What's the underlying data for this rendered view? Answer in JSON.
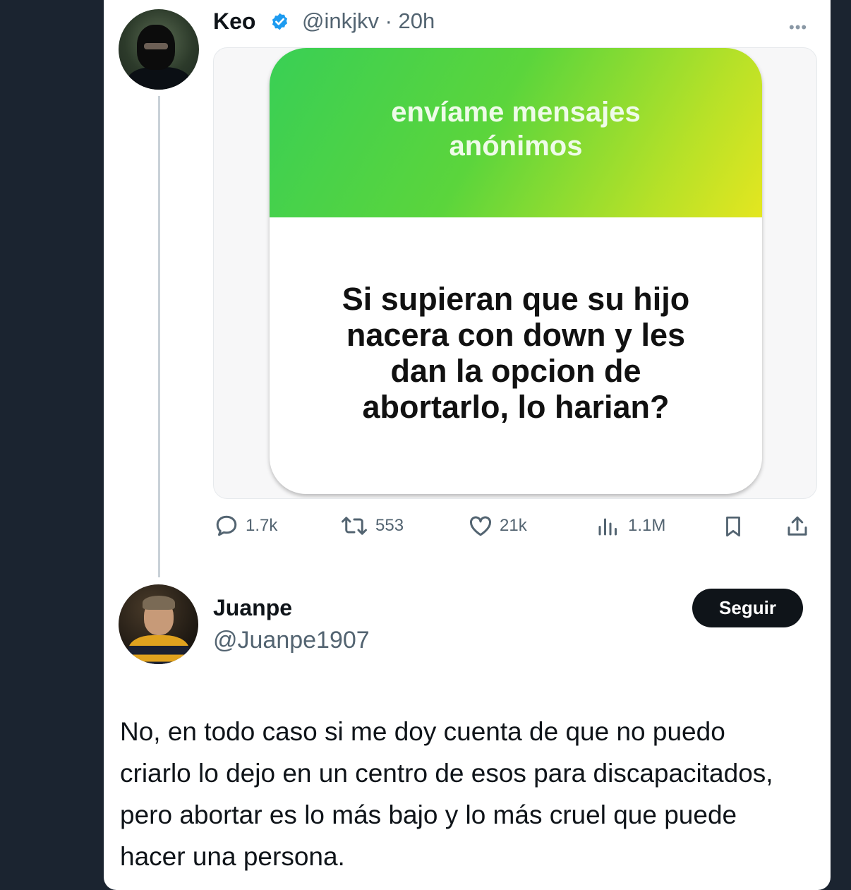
{
  "tweet": {
    "author_name": "Keo",
    "verified_icon": "verified-badge-icon",
    "handle_time": "@inkjkv · 20h",
    "more_icon": "more-options-icon",
    "sticker": {
      "title": "envíame mensajes anónimos",
      "question": "Si supieran que su hijo nacera con down y les dan la opcion de abortarlo, lo harian?"
    },
    "actions": {
      "replies": "1.7k",
      "reposts": "553",
      "likes": "21k",
      "views": "1.1M"
    }
  },
  "reply": {
    "author_name": "Juanpe",
    "handle": "@Juanpe1907",
    "follow_label": "Seguir",
    "text": "No, en todo caso si me doy cuenta de que no puedo criarlo lo dejo en un centro de esos para discapacitados, pero abortar es lo más bajo y lo más cruel que puede hacer una persona."
  },
  "colors": {
    "background": "#1b2430",
    "accent_blue": "#1d9bf0",
    "sticker_gradient_start": "#39cf55",
    "sticker_gradient_end": "#e4e620"
  }
}
